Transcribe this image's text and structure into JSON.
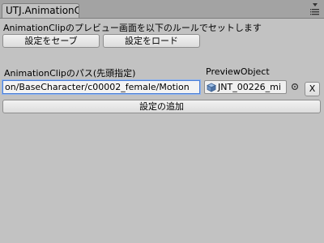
{
  "window": {
    "tab_title": "UTJ.AnimationC"
  },
  "main": {
    "description": "AnimationClipのプレビュー画面を以下のルールでセットします",
    "save_button": "設定をセーブ",
    "load_button": "設定をロード",
    "path_label": "AnimationClipのパス(先頭指定)",
    "preview_label": "PreviewObject",
    "path_value": "on/BaseCharacter/c00002_female/Motion",
    "preview_object": "JNT_00226_mi",
    "clear_button": "X",
    "add_button": "設定の追加"
  },
  "icons": {
    "menu": "tab-menu-icon",
    "object": "gameobject-icon",
    "picker": "object-picker-icon"
  }
}
